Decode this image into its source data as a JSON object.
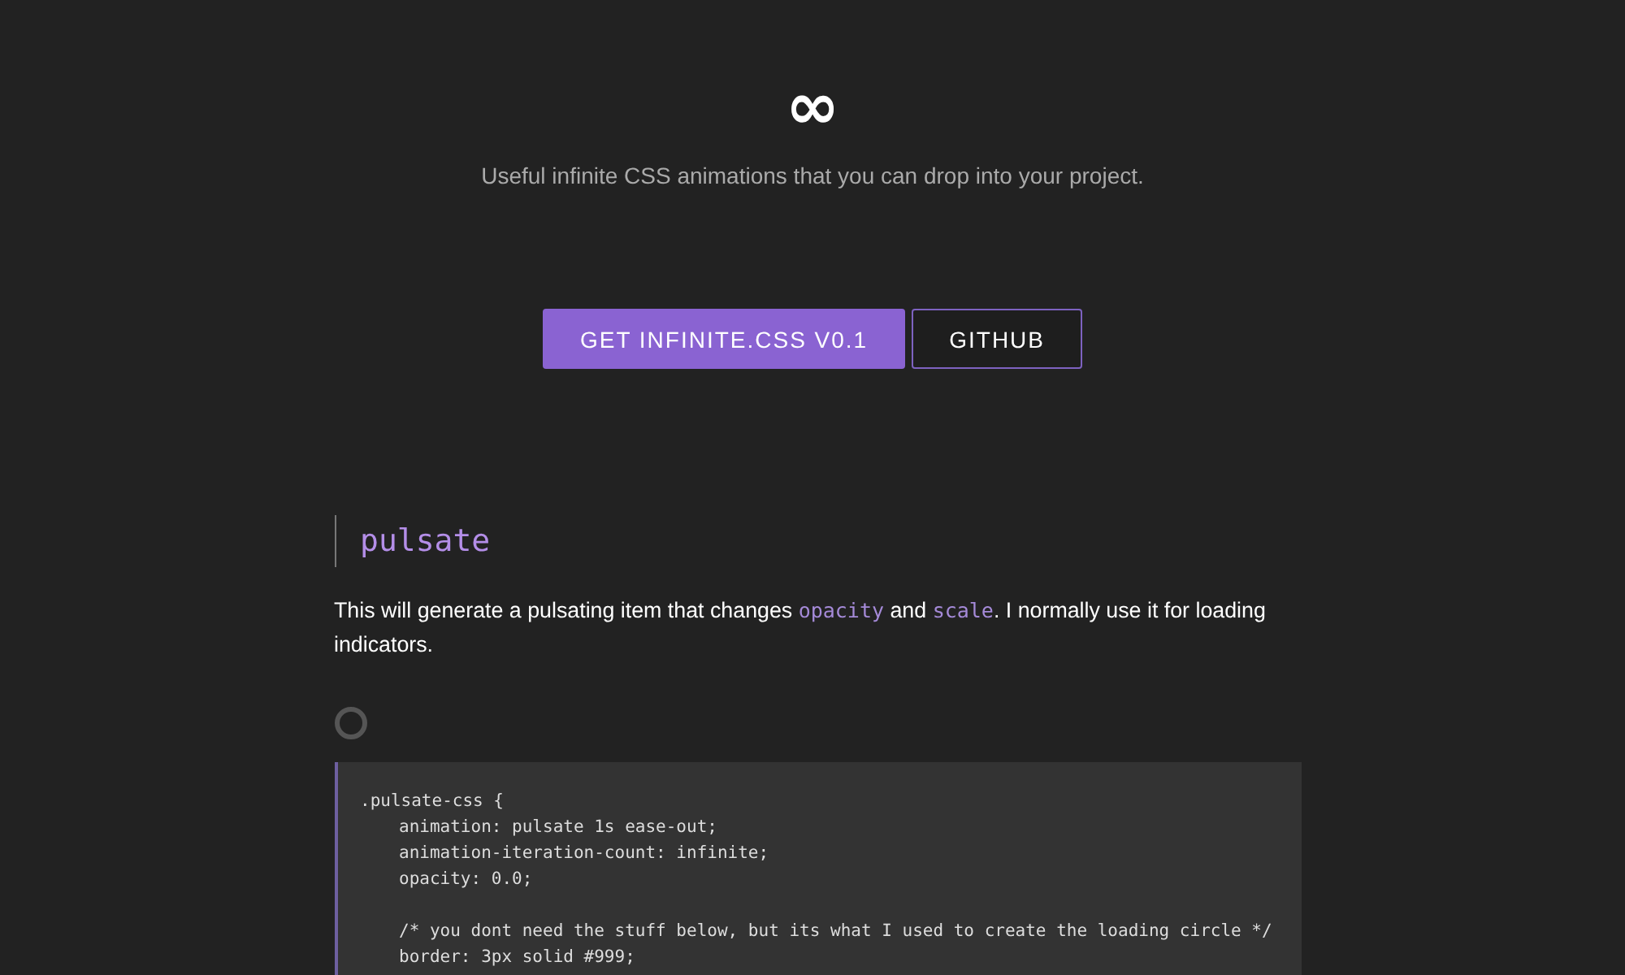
{
  "logo": "∞",
  "tagline": "Useful infinite CSS animations that you can drop into your project.",
  "buttons": [
    {
      "label": "GET INFINITE.CSS V0.1",
      "kind": "primary"
    },
    {
      "label": "GITHUB",
      "kind": "outline"
    }
  ],
  "section": {
    "title": "pulsate",
    "description": [
      {
        "kind": "text",
        "text": "This will generate a pulsating item that changes "
      },
      {
        "kind": "code",
        "text": "opacity"
      },
      {
        "kind": "text",
        "text": " and "
      },
      {
        "kind": "code",
        "text": "scale"
      },
      {
        "kind": "text",
        "text": ". I normally use it for loading indicators."
      }
    ],
    "code_lines": [
      {
        "text": ".pulsate-css {",
        "indent": false,
        "gap_before": false
      },
      {
        "text": "animation: pulsate 1s ease-out;",
        "indent": true,
        "gap_before": false
      },
      {
        "text": "animation-iteration-count: infinite;",
        "indent": true,
        "gap_before": false
      },
      {
        "text": "opacity: 0.0;",
        "indent": true,
        "gap_before": false
      },
      {
        "text": "/* you dont need the stuff below, but its what I used to create the loading circle */",
        "indent": true,
        "gap_before": true
      },
      {
        "text": "border: 3px solid #999;",
        "indent": true,
        "gap_before": false
      }
    ]
  }
}
